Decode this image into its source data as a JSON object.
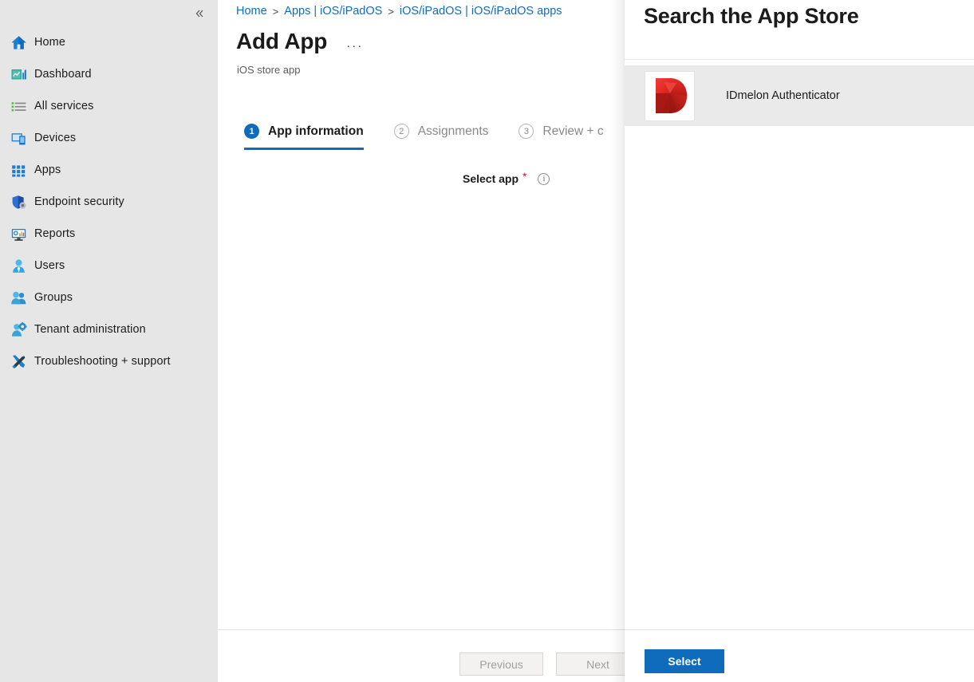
{
  "sidebar": {
    "collapse_label": "«",
    "items": [
      {
        "label": "Home",
        "icon": "home-icon"
      },
      {
        "label": "Dashboard",
        "icon": "dashboard-icon"
      },
      {
        "label": "All services",
        "icon": "all-services-icon"
      },
      {
        "label": "Devices",
        "icon": "devices-icon"
      },
      {
        "label": "Apps",
        "icon": "apps-grid-icon"
      },
      {
        "label": "Endpoint security",
        "icon": "shield-gear-icon"
      },
      {
        "label": "Reports",
        "icon": "reports-monitor-icon"
      },
      {
        "label": "Users",
        "icon": "user-icon"
      },
      {
        "label": "Groups",
        "icon": "groups-icon"
      },
      {
        "label": "Tenant administration",
        "icon": "tenant-admin-icon"
      },
      {
        "label": "Troubleshooting + support",
        "icon": "wrench-screwdriver-icon"
      }
    ]
  },
  "breadcrumb": {
    "items": [
      "Home",
      "Apps | iOS/iPadOS",
      "iOS/iPadOS | iOS/iPadOS apps"
    ],
    "separator": ">"
  },
  "header": {
    "title": "Add App",
    "subtitle": "iOS store app",
    "more_menu": "···"
  },
  "tabs": [
    {
      "number": "1",
      "label": "App information",
      "state": "active"
    },
    {
      "number": "2",
      "label": "Assignments",
      "state": "inactive"
    },
    {
      "number": "3",
      "label": "Review + c",
      "state": "inactive"
    }
  ],
  "form": {
    "select_app_label": "Select app",
    "required_marker": "*",
    "info_icon_glyph": "i",
    "search_store_link": "Search the App Store"
  },
  "footer": {
    "previous_label": "Previous",
    "next_label": "Next"
  },
  "blade": {
    "title": "Search the App Store",
    "results": [
      {
        "name": "IDmelon Authenticator",
        "icon": "idmelon-app-icon",
        "selected": true
      }
    ],
    "select_label": "Select"
  },
  "colors": {
    "accent": "#0f6cbd",
    "sidebar_bg": "#e6e6e6",
    "selected_row_bg": "#eaeaea",
    "required_red": "#a4262c",
    "app_icon_red": "#e0251d"
  }
}
